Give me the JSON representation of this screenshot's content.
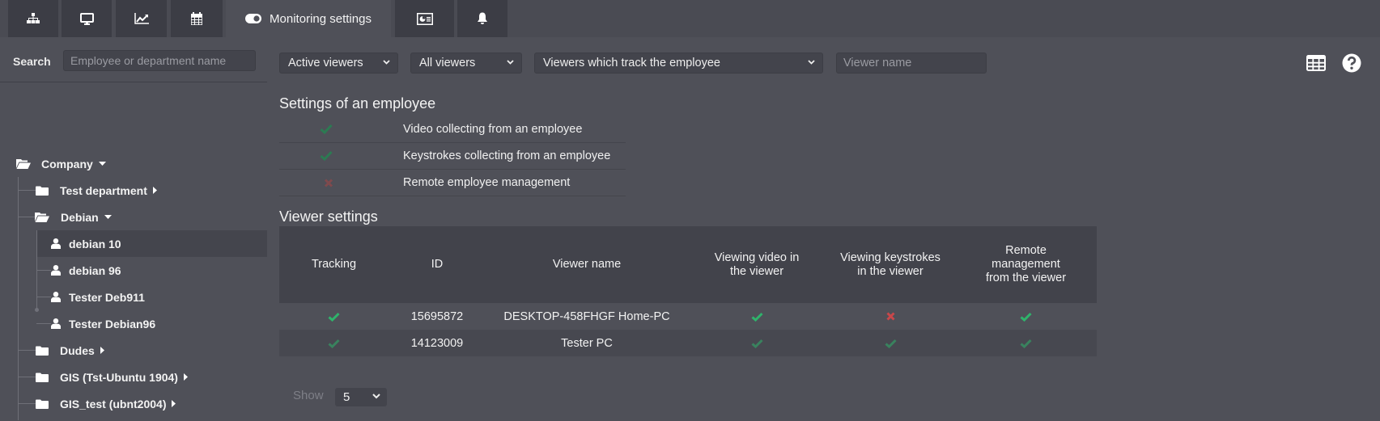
{
  "tabs": [
    {
      "id": "structure",
      "icon": "sitemap-icon",
      "label": ""
    },
    {
      "id": "computers",
      "icon": "monitor-icon",
      "label": ""
    },
    {
      "id": "charts",
      "icon": "line-chart-icon",
      "label": ""
    },
    {
      "id": "calendar",
      "icon": "calendar-icon",
      "label": ""
    },
    {
      "id": "monitoring",
      "icon": "toggle-icon",
      "label": "Monitoring settings",
      "active": true
    },
    {
      "id": "reports",
      "icon": "id-card-icon",
      "label": ""
    },
    {
      "id": "notifications",
      "icon": "bell-icon",
      "label": ""
    }
  ],
  "sidebar": {
    "search_label": "Search",
    "search_placeholder": "Employee or department name",
    "tree": [
      {
        "name": "Company",
        "type": "folder-open",
        "expanded": true
      },
      {
        "name": "Test department",
        "type": "folder",
        "expanded": false
      },
      {
        "name": "Debian",
        "type": "folder-open",
        "expanded": true
      },
      {
        "name": "debian 10",
        "type": "user",
        "selected": true
      },
      {
        "name": "debian 96",
        "type": "user"
      },
      {
        "name": "Tester Deb911",
        "type": "user"
      },
      {
        "name": "Tester Debian96",
        "type": "user"
      },
      {
        "name": "Dudes",
        "type": "folder",
        "expanded": false
      },
      {
        "name": "GIS (Tst-Ubuntu 1904)",
        "type": "folder",
        "expanded": false
      },
      {
        "name": "GIS_test (ubnt2004)",
        "type": "folder",
        "expanded": false
      }
    ]
  },
  "toolbar": {
    "filter1": "Active viewers",
    "filter2": "All viewers",
    "filter3": "Viewers which track the employee",
    "viewer_name_placeholder": "Viewer name"
  },
  "employee_settings": {
    "title": "Settings of an employee",
    "items": [
      {
        "label": "Video collecting from an employee",
        "enabled": true
      },
      {
        "label": "Keystrokes collecting from an employee",
        "enabled": true
      },
      {
        "label": "Remote employee management",
        "enabled": false
      }
    ]
  },
  "viewer_settings": {
    "title": "Viewer settings",
    "columns": [
      "Tracking",
      "ID",
      "Viewer name",
      "Viewing video in the viewer",
      "Viewing keystrokes in the viewer",
      "Remote management from the viewer"
    ],
    "rows": [
      {
        "tracking": true,
        "id": "15695872",
        "name": "DESKTOP-458FHGF Home-PC",
        "video": true,
        "keystrokes": false,
        "remote": true
      },
      {
        "tracking": true,
        "id": "14123009",
        "name": "Tester PC",
        "video": true,
        "keystrokes": true,
        "remote": true
      }
    ]
  },
  "pagination": {
    "show_label": "Show",
    "page_size": "5"
  },
  "colors": {
    "check": "#2fb36b",
    "cross": "#c9474a"
  }
}
